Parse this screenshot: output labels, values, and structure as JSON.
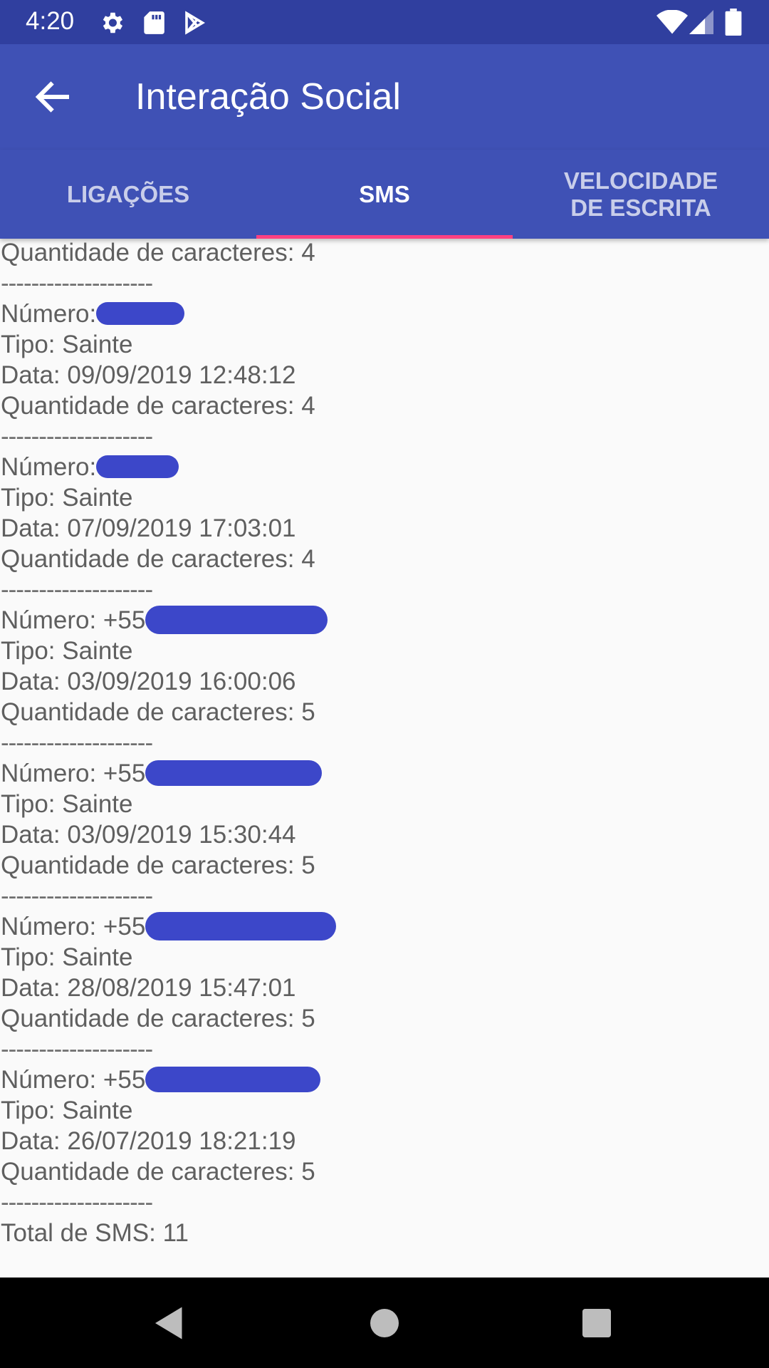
{
  "status_bar": {
    "time": "4:20"
  },
  "app_bar": {
    "title": "Interação Social"
  },
  "tabs": [
    {
      "label": "LIGAÇÕES",
      "active": false
    },
    {
      "label": "SMS",
      "active": true
    },
    {
      "label": "VELOCIDADE DE ESCRITA",
      "active": false
    }
  ],
  "separator": "--------------------",
  "first_partial_line": "Quantidade de caracteres: 4",
  "messages": [
    {
      "numero": "Número:",
      "tipo": "Tipo: Sainte",
      "data": "Data: 09/09/2019 12:48:12",
      "quantidade": "Quantidade de caracteres: 4"
    },
    {
      "numero": "Número:",
      "tipo": "Tipo: Sainte",
      "data": "Data: 07/09/2019 17:03:01",
      "quantidade": "Quantidade de caracteres: 4"
    },
    {
      "numero": "Número: +55",
      "tipo": "Tipo: Sainte",
      "data": "Data: 03/09/2019 16:00:06",
      "quantidade": "Quantidade de caracteres: 5"
    },
    {
      "numero": "Número: +55",
      "tipo": "Tipo: Sainte",
      "data": "Data: 03/09/2019 15:30:44",
      "quantidade": "Quantidade de caracteres: 5"
    },
    {
      "numero": "Número: +55",
      "tipo": "Tipo: Sainte",
      "data": "Data: 28/08/2019 15:47:01",
      "quantidade": "Quantidade de caracteres: 5"
    },
    {
      "numero": "Número: +55",
      "tipo": "Tipo: Sainte",
      "data": "Data: 26/07/2019 18:21:19",
      "quantidade": "Quantidade de caracteres: 5"
    }
  ],
  "total": "Total de SMS: 11",
  "colors": {
    "primary": "#3f51b5",
    "primary_dark": "#303f9f",
    "accent": "#ff4081",
    "redaction": "#3c47c9"
  }
}
